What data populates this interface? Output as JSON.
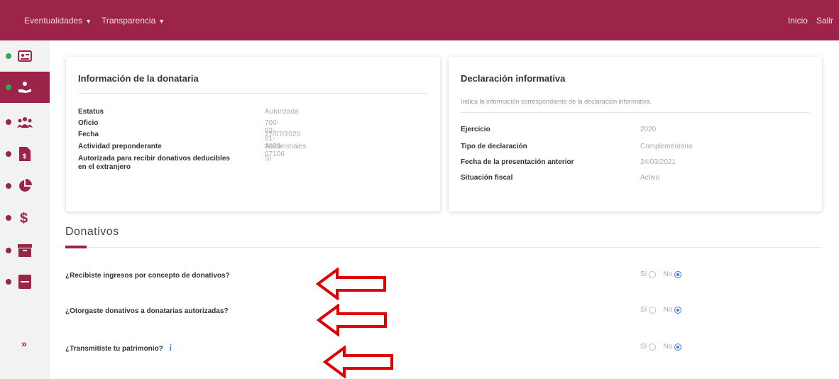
{
  "nav": {
    "menu": [
      {
        "label": "Eventualidades",
        "caret": "▼"
      },
      {
        "label": "Transparencia",
        "caret": "▼"
      }
    ],
    "right": [
      "Inicio",
      "Salir"
    ]
  },
  "sidebar": {
    "icons": [
      "id-card-icon",
      "hand-donation-icon",
      "people-icon",
      "document-dollar-icon",
      "pie-chart-icon",
      "dollar-icon",
      "archive-box-icon",
      "book-icon"
    ],
    "expand_label": "»"
  },
  "donataria": {
    "title": "Información de la donataria",
    "rows": [
      {
        "label": "Estatus",
        "value": "Autorizada"
      },
      {
        "label": "Oficio",
        "value": "700-02-01-2020-07106"
      },
      {
        "label": "Fecha",
        "value": "27/07/2020"
      },
      {
        "label": "Actividad preponderante",
        "value": "Asistenciales"
      },
      {
        "label": "Autorizada para recibir donativos deducibles en el extranjero",
        "value": "Sí"
      }
    ]
  },
  "declaracion": {
    "title": "Declaración informativa",
    "description": "Indica la información correspondiente de la declaración informativa.",
    "rows": [
      {
        "label": "Ejercicio",
        "value": "2020"
      },
      {
        "label": "Tipo de declaración",
        "value": "Complementaria"
      },
      {
        "label": "Fecha de la presentación anterior",
        "value": "24/03/2021"
      },
      {
        "label": "Situación fiscal",
        "value": "Activo"
      }
    ]
  },
  "donativos": {
    "title": "Donativos",
    "questions": [
      {
        "text": "¿Recibiste ingresos por concepto de donativos?",
        "yes": "Sí",
        "no": "No",
        "selected": "No"
      },
      {
        "text": "¿Otorgaste donativos a donatarias autorizadas?",
        "yes": "Sí",
        "no": "No",
        "selected": "No"
      },
      {
        "text": "¿Transmitiste tu patrimonio?",
        "info_icon": "i",
        "yes": "Sí",
        "no": "No",
        "selected": "No"
      }
    ]
  },
  "colors": {
    "brand": "#9d2449",
    "accent": "#3a7bd5",
    "active_dot": "#2eab56",
    "arrow": "#e00000"
  }
}
